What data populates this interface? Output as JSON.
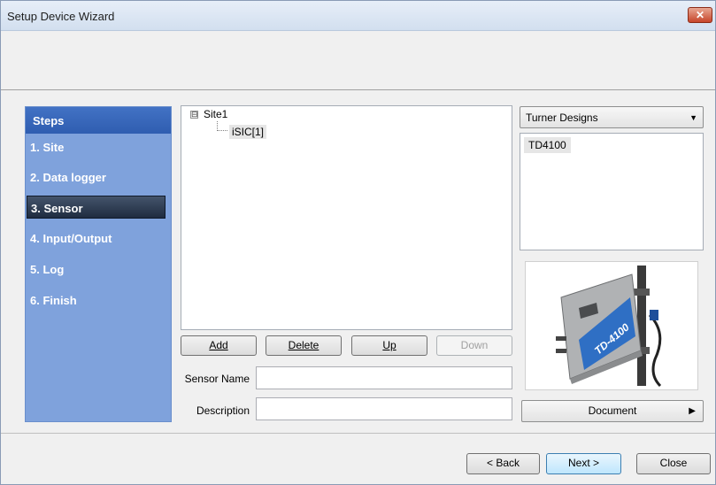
{
  "window": {
    "title": "Setup Device Wizard",
    "close_glyph": "✕"
  },
  "steps": {
    "header": "Steps",
    "items": [
      {
        "label": "1. Site"
      },
      {
        "label": "2. Data logger"
      },
      {
        "label": "3. Sensor",
        "active": true
      },
      {
        "label": "4. Input/Output"
      },
      {
        "label": "5. Log"
      },
      {
        "label": "6. Finish"
      }
    ]
  },
  "tree": {
    "expander": "⊟",
    "root": "Site1",
    "child": "iSIC[1]"
  },
  "tree_buttons": {
    "add": "Add",
    "delete": "Delete",
    "up": "Up",
    "down": "Down"
  },
  "form": {
    "sensor_name_label": "Sensor Name",
    "sensor_name_value": "",
    "description_label": "Description",
    "description_value": ""
  },
  "manufacturer": {
    "selected": "Turner Designs",
    "arrow": "▼"
  },
  "models": [
    "TD4100"
  ],
  "device_image": {
    "label": "TD-4100"
  },
  "document_button": {
    "label": "Document",
    "arrow": "▶"
  },
  "footer": {
    "back": "< Back",
    "next": "Next >",
    "close": "Close"
  },
  "colors": {
    "steps_panel": "#7fa2dc",
    "steps_header": "#3563b8",
    "active_step": "#2c3a50",
    "device_blue": "#2f6fc4"
  }
}
